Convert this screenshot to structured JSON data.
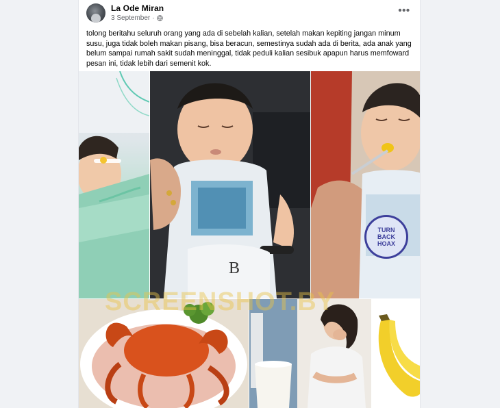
{
  "post": {
    "author": "La Ode Miran",
    "date": "3 September",
    "visibility_icon": "globe-icon",
    "more_options_label": "•••",
    "text": "tolong beritahu seluruh orang yang ada di sebelah kalian, setelah makan kepiting jangan minum susu, juga tidak boleh makan pisang, bisa beracun, semestinya sudah ada di berita, ada anak yang belum sampai rumah sakit sudah meninggal, tidak peduli kalian sesibuk apapun harus memfoward pesan ini, tidak lebih dari semenit kok."
  },
  "photos": {
    "watermark": "SCREENSHOT.BY",
    "badge_text": "TURN BACK HOAX",
    "glass_milk_color": "#f7f5ef",
    "crab_color": "#d9521d",
    "banana_color": "#f2cf2a"
  }
}
